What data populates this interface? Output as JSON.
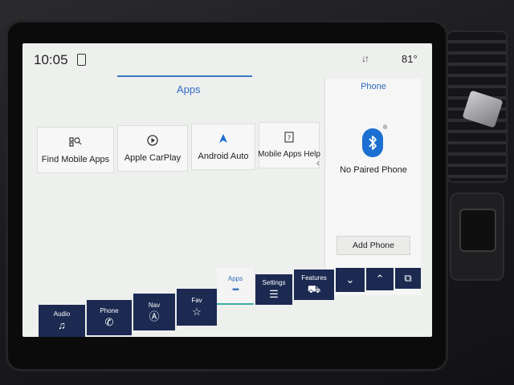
{
  "status": {
    "time": "10:05",
    "temperature": "81°"
  },
  "apps": {
    "title": "Apps",
    "tiles": [
      {
        "label": "Find Mobile Apps",
        "icon": "find-apps-icon"
      },
      {
        "label": "Apple CarPlay",
        "icon": "carplay-icon"
      },
      {
        "label": "Android Auto",
        "icon": "android-auto-icon"
      },
      {
        "label": "Mobile Apps Help",
        "icon": "help-icon"
      }
    ]
  },
  "phone": {
    "title": "Phone",
    "status": "No Paired Phone",
    "add_label": "Add Phone",
    "icon": "bluetooth-icon"
  },
  "nav": {
    "items": [
      {
        "label": "Audio",
        "icon": "music-note-icon"
      },
      {
        "label": "Phone",
        "icon": "phone-icon"
      },
      {
        "label": "Nav",
        "icon": "navigation-icon"
      },
      {
        "label": "Fav",
        "icon": "star-icon"
      },
      {
        "label": "Apps",
        "icon": "grid-icon",
        "active": true
      },
      {
        "label": "Settings",
        "icon": "sliders-icon"
      },
      {
        "label": "Features",
        "icon": "truck-icon"
      },
      {
        "label": "",
        "icon": "chevron-down-icon"
      },
      {
        "label": "",
        "icon": "chevron-up-icon"
      },
      {
        "label": "",
        "icon": "window-icon"
      }
    ]
  },
  "colors": {
    "accent": "#2f6bbf",
    "nav_bg": "#1c2a52",
    "bluetooth": "#1d6fd1"
  }
}
